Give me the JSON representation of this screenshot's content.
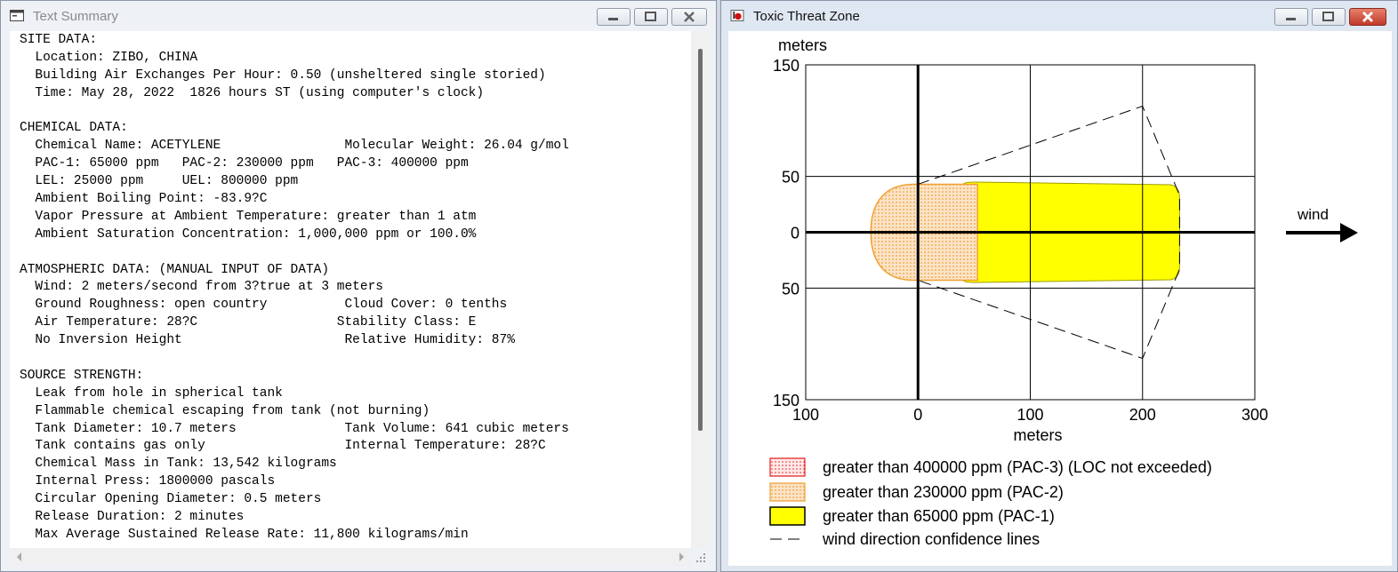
{
  "summary_window": {
    "title": "Text Summary",
    "lines": [
      "SITE DATA:",
      "  Location: ZIBO, CHINA",
      "  Building Air Exchanges Per Hour: 0.50 (unsheltered single storied)",
      "  Time: May 28, 2022  1826 hours ST (using computer's clock)",
      "",
      "CHEMICAL DATA:",
      "  Chemical Name: ACETYLENE                Molecular Weight: 26.04 g/mol",
      "  PAC-1: 65000 ppm   PAC-2: 230000 ppm   PAC-3: 400000 ppm",
      "  LEL: 25000 ppm     UEL: 800000 ppm",
      "  Ambient Boiling Point: -83.9?C",
      "  Vapor Pressure at Ambient Temperature: greater than 1 atm",
      "  Ambient Saturation Concentration: 1,000,000 ppm or 100.0%",
      "",
      "ATMOSPHERIC DATA: (MANUAL INPUT OF DATA)",
      "  Wind: 2 meters/second from 3?true at 3 meters",
      "  Ground Roughness: open country          Cloud Cover: 0 tenths",
      "  Air Temperature: 28?C                  Stability Class: E",
      "  No Inversion Height                     Relative Humidity: 87%",
      "",
      "SOURCE STRENGTH:",
      "  Leak from hole in spherical tank",
      "  Flammable chemical escaping from tank (not burning)",
      "  Tank Diameter: 10.7 meters              Tank Volume: 641 cubic meters",
      "  Tank contains gas only                  Internal Temperature: 28?C",
      "  Chemical Mass in Tank: 13,542 kilograms",
      "  Internal Press: 1800000 pascals",
      "  Circular Opening Diameter: 0.5 meters",
      "  Release Duration: 2 minutes",
      "  Max Average Sustained Release Rate: 11,800 kilograms/min"
    ]
  },
  "plot_window": {
    "title": "Toxic Threat Zone",
    "wind_label": "wind",
    "legend": [
      {
        "label": "greater than 400000 ppm (PAC-3) (LOC not exceeded)",
        "color": "#e02020"
      },
      {
        "label": "greater than 230000 ppm (PAC-2)",
        "color": "#f0a030"
      },
      {
        "label": "greater than 65000 ppm (PAC-1)",
        "color": "#ffff00"
      },
      {
        "label": "wind direction confidence lines",
        "color": "#000000"
      }
    ]
  },
  "chart_data": {
    "type": "area",
    "xlabel": "meters",
    "ylabel": "meters",
    "xlim": [
      -100,
      300
    ],
    "ylim": [
      -150,
      150
    ],
    "x_ticks": [
      100,
      0,
      100,
      200,
      300
    ],
    "y_ticks": [
      150,
      50,
      0,
      50,
      150
    ],
    "grid": true,
    "zones": [
      {
        "name": "greater than 65000 ppm (PAC-1)",
        "x_min": 40,
        "x_max": 233,
        "half_width": 45
      },
      {
        "name": "greater than 230000 ppm (PAC-2)",
        "x_min": -42,
        "x_max": 53,
        "half_width": 43
      }
    ],
    "confidence_lines": [
      [
        0,
        43
      ],
      [
        200,
        113
      ],
      [
        233,
        33
      ],
      [
        233,
        -33
      ],
      [
        200,
        -113
      ],
      [
        0,
        -43
      ]
    ]
  }
}
